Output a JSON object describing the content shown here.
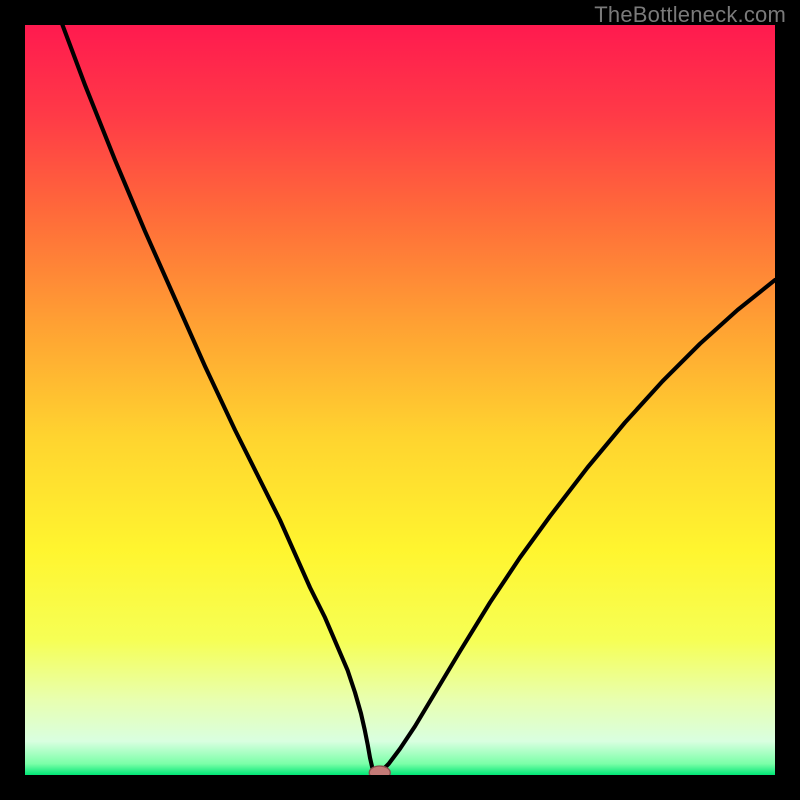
{
  "watermark": "TheBottleneck.com",
  "colors": {
    "background": "#000000",
    "gradient_stops": [
      {
        "offset": 0.0,
        "color": "#ff1a4f"
      },
      {
        "offset": 0.12,
        "color": "#ff3a47"
      },
      {
        "offset": 0.25,
        "color": "#ff6a3a"
      },
      {
        "offset": 0.4,
        "color": "#ffa133"
      },
      {
        "offset": 0.55,
        "color": "#ffd42f"
      },
      {
        "offset": 0.7,
        "color": "#fff52f"
      },
      {
        "offset": 0.82,
        "color": "#f6ff55"
      },
      {
        "offset": 0.9,
        "color": "#e8ffb0"
      },
      {
        "offset": 0.955,
        "color": "#d9ffe0"
      },
      {
        "offset": 0.985,
        "color": "#7bffa8"
      },
      {
        "offset": 1.0,
        "color": "#00e676"
      }
    ],
    "curve": "#000000",
    "marker_fill": "#c47a77",
    "marker_stroke": "#8a4e4c"
  },
  "chart_data": {
    "type": "line",
    "title": "",
    "xlabel": "",
    "ylabel": "",
    "xlim": [
      0,
      100
    ],
    "ylim": [
      0,
      100
    ],
    "legend": false,
    "grid": false,
    "series": [
      {
        "name": "bottleneck-curve",
        "x": [
          0,
          2,
          5,
          8,
          12,
          16,
          20,
          24,
          28,
          31,
          34,
          36,
          38,
          40,
          41.5,
          43,
          44,
          44.8,
          45.3,
          45.7,
          46,
          46.3,
          46.8,
          47.5,
          48.5,
          50,
          52,
          55,
          58,
          62,
          66,
          70,
          75,
          80,
          85,
          90,
          95,
          100
        ],
        "y": [
          113,
          108,
          100,
          92,
          82,
          72.5,
          63.5,
          54.5,
          46,
          40,
          34,
          29.5,
          25,
          21,
          17.5,
          14,
          11,
          8.2,
          6.0,
          4.0,
          2.3,
          1.0,
          0.3,
          0.5,
          1.5,
          3.5,
          6.5,
          11.5,
          16.5,
          23,
          29,
          34.5,
          41,
          47,
          52.5,
          57.5,
          62,
          66
        ]
      }
    ],
    "marker": {
      "x": 47.3,
      "y": 0.3,
      "rx": 1.4,
      "ry": 0.9
    }
  }
}
